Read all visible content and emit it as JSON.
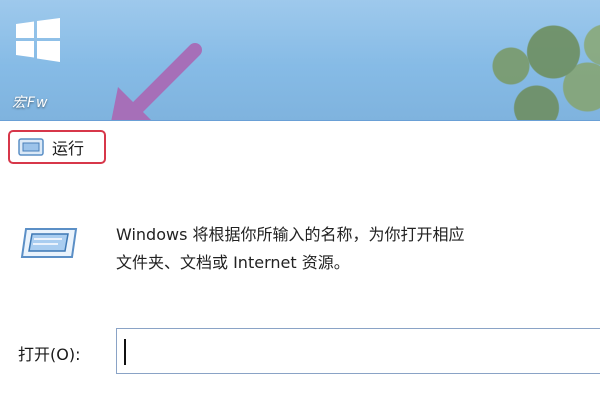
{
  "desktop": {
    "icon_label": "宏Fw",
    "colors": {
      "sky": "#8fbfe6",
      "arrow": "#a66fb8"
    }
  },
  "dialog": {
    "title": "运行",
    "title_highlight_color": "#d7374a",
    "description_line1": "Windows 将根据你所输入的名称，为你打开相应",
    "description_line2": "文件夹、文档或 Internet 资源。",
    "open_label": "打开(O):",
    "open_value": "",
    "open_placeholder": ""
  }
}
